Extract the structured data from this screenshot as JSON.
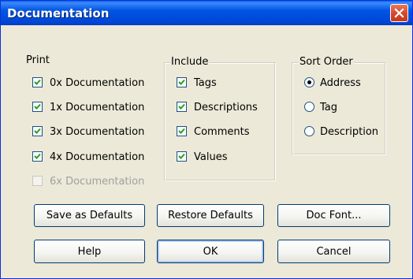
{
  "window": {
    "title": "Documentation"
  },
  "print": {
    "label": "Print",
    "items": [
      {
        "label": "0x Documentation",
        "checked": true,
        "enabled": true
      },
      {
        "label": "1x Documentation",
        "checked": true,
        "enabled": true
      },
      {
        "label": "3x Documentation",
        "checked": true,
        "enabled": true
      },
      {
        "label": "4x Documentation",
        "checked": true,
        "enabled": true
      },
      {
        "label": "6x Documentation",
        "checked": false,
        "enabled": false
      }
    ]
  },
  "include": {
    "label": "Include",
    "items": [
      {
        "label": "Tags",
        "checked": true
      },
      {
        "label": "Descriptions",
        "checked": true
      },
      {
        "label": "Comments",
        "checked": true
      },
      {
        "label": "Values",
        "checked": true
      }
    ]
  },
  "sort_order": {
    "label": "Sort Order",
    "options": [
      {
        "label": "Address",
        "selected": true
      },
      {
        "label": "Tag",
        "selected": false
      },
      {
        "label": "Description",
        "selected": false
      }
    ]
  },
  "buttons": {
    "save_defaults": "Save as Defaults",
    "restore_defaults": "Restore Defaults",
    "doc_font": "Doc Font...",
    "help": "Help",
    "ok": "OK",
    "cancel": "Cancel"
  },
  "colors": {
    "titlebar": "#0054e3",
    "face": "#ece9d8",
    "close": "#d6452a"
  }
}
